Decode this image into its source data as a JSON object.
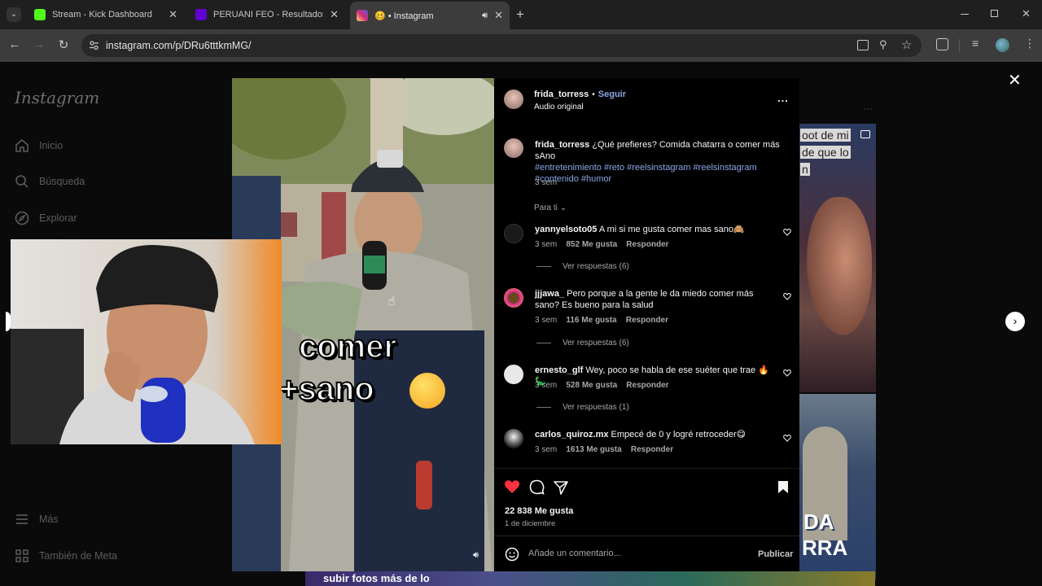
{
  "browser": {
    "tabs": [
      {
        "title": "Stream - Kick Dashboard",
        "favicon_color": "#53fc18"
      },
      {
        "title": "PERUANI FEO - Resultados de Y",
        "favicon_color": "#6001d2"
      },
      {
        "title": "🥴 • Instagram",
        "favicon_color": "#d6249f"
      }
    ],
    "new_tab": "+",
    "url": "instagram.com/p/DRu6tttkmMG/"
  },
  "sidebar": {
    "logo": "Instagram",
    "items": [
      {
        "label": "Inicio",
        "icon": "home-icon"
      },
      {
        "label": "Búsqueda",
        "icon": "search-icon"
      },
      {
        "label": "Explorar",
        "icon": "compass-icon"
      },
      {
        "label": "Más",
        "icon": "menu-icon"
      },
      {
        "label": "También de Meta",
        "icon": "meta-icon"
      }
    ]
  },
  "media": {
    "caption_line1": "comer",
    "caption_line2": "+sano",
    "bottom_text": "subir fotos más de lo"
  },
  "background_posts": {
    "text_line1": "oot de mi",
    "text_line2": "de que lo",
    "text_line3": "n",
    "lower_text_1": "DA",
    "lower_text_2": "RRA"
  },
  "post": {
    "username": "frida_torress",
    "separator": "•",
    "follow": "Seguir",
    "audio": "Audio original",
    "more": "...",
    "caption_user": "frida_torress",
    "caption_text": "¿Qué prefieres? Comida chatarra o comer más sAno",
    "hashtags_line1": "#entretenimiento #reto #reelsinstagram #reelsinstagram",
    "hashtags_line2": "#contenido #humor",
    "caption_time": "3 sem",
    "filter": "Para ti",
    "likes": "22 838 Me gusta",
    "date": "1 de diciembre",
    "comment_placeholder": "Añade un comentario...",
    "publish": "Publicar"
  },
  "comments": [
    {
      "user": "yannyelsoto05",
      "text": "A mi si me gusta comer mas sano🙈",
      "time": "3 sem",
      "likes": "852 Me gusta",
      "reply": "Responder",
      "view_replies": "Ver respuestas (6)",
      "avatar_color": "#1a1a1a"
    },
    {
      "user": "jjjawa_",
      "text": "Pero porque a la gente le da miedo comer más sano? Es bueno para la salud",
      "time": "3 sem",
      "likes": "116 Me gusta",
      "reply": "Responder",
      "view_replies": "Ver respuestas (6)",
      "avatar_color": "#6a4a1a"
    },
    {
      "user": "ernesto_glf",
      "text": "Wey, poco se habla de ese suéter que trae 🔥🦕",
      "time": "3 sem",
      "likes": "528 Me gusta",
      "reply": "Responder",
      "view_replies": "Ver respuestas (1)",
      "avatar_color": "#e8e8e8"
    },
    {
      "user": "carlos_quiroz.mx",
      "text": "Empecé de 0 y logré retroceder😋",
      "time": "3 sem",
      "likes": "1613 Me gusta",
      "reply": "Responder",
      "view_replies": "",
      "avatar_color": "#dcdcdc"
    }
  ],
  "colors": {
    "accent_link": "#8aa7e6",
    "like_red": "#ff3040",
    "browser_bg": "#1f1f1f",
    "toolbar_bg": "#3c3c3c"
  }
}
